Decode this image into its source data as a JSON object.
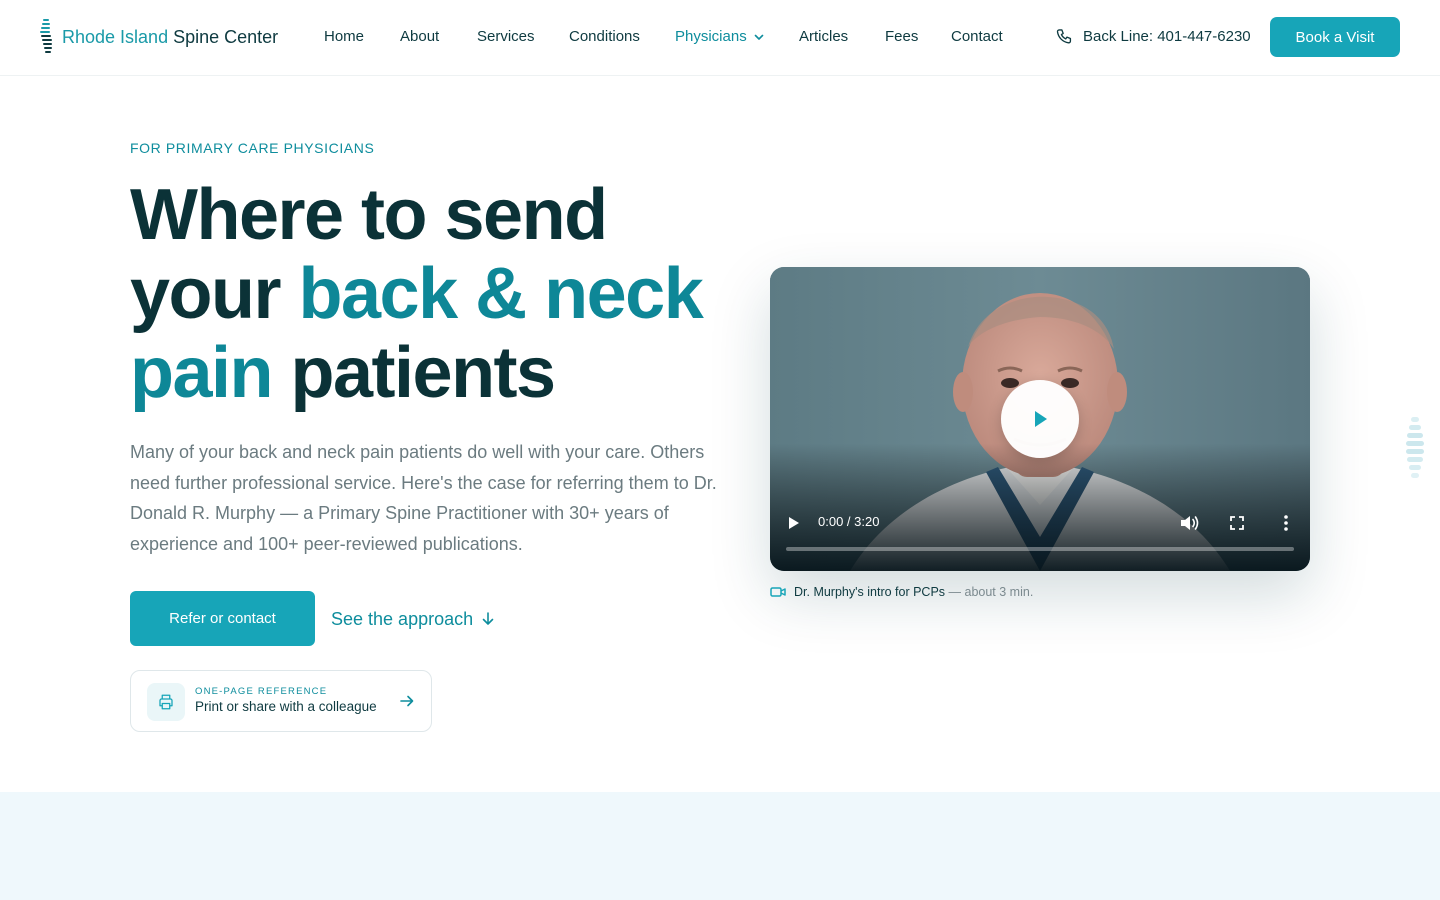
{
  "header": {
    "logo": {
      "part1": "Rhode Island",
      "part2": "Spine Center"
    },
    "nav": [
      "Home",
      "About",
      "Services",
      "Conditions",
      "Physicians",
      "Articles",
      "Fees",
      "Contact"
    ],
    "active_nav": "Physicians",
    "phone_label": "Back Line: 401-447-6230",
    "cta": "Book a Visit"
  },
  "hero": {
    "eyebrow": "FOR PRIMARY CARE PHYSICIANS",
    "headline": {
      "part1": "Where to send your ",
      "highlight1": "back & neck",
      "space": " ",
      "highlight2": "pain",
      "part2": " patients"
    },
    "lede": "Many of your back and neck pain patients do well with your care. Others need further professional service. Here's the case for referring them to Dr. Donald R. Murphy — a Primary Spine Practitioner with 30+ years of experience and 100+ peer-reviewed publications.",
    "primary_cta": "Refer or contact",
    "secondary_cta": "See the approach",
    "reference_card": {
      "eyebrow": "ONE-PAGE REFERENCE",
      "label": "Print or share with a colleague"
    }
  },
  "video": {
    "time": "0:00 / 3:20",
    "progress": 0,
    "caption_title": "Dr. Murphy's intro for PCPs",
    "caption_meta": " — about 3 min."
  },
  "colors": {
    "accent": "#17a5b8",
    "heading": "#0b3237",
    "highlight": "#0e8797",
    "band": "#eff8fc"
  }
}
